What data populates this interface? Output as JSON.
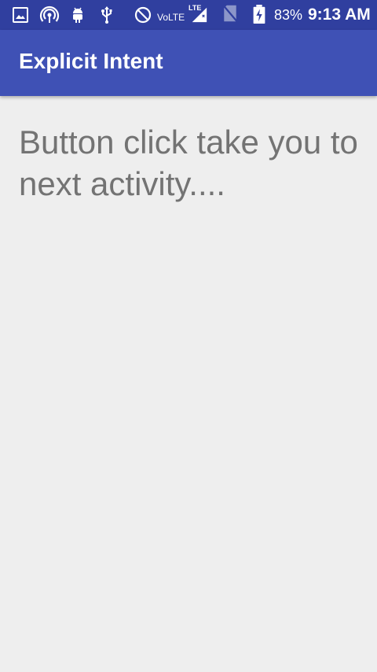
{
  "status_bar": {
    "icons": [
      "image-icon",
      "hotspot-icon",
      "android-icon",
      "usb-icon",
      "do-not-disturb-icon",
      "volte-icon",
      "lte-signal-icon",
      "no-sim-icon",
      "battery-charging-icon"
    ],
    "volte_label": "VoLTE",
    "lte_label": "LTE",
    "battery": "83%",
    "time": "9:13 AM"
  },
  "app_bar": {
    "title": "Explicit Intent"
  },
  "main": {
    "message": "Button click take you to next activity...."
  },
  "colors": {
    "status_bar": "#303f9f",
    "app_bar": "#3f51b5",
    "background": "#eeeeee",
    "message_text": "#737373"
  }
}
